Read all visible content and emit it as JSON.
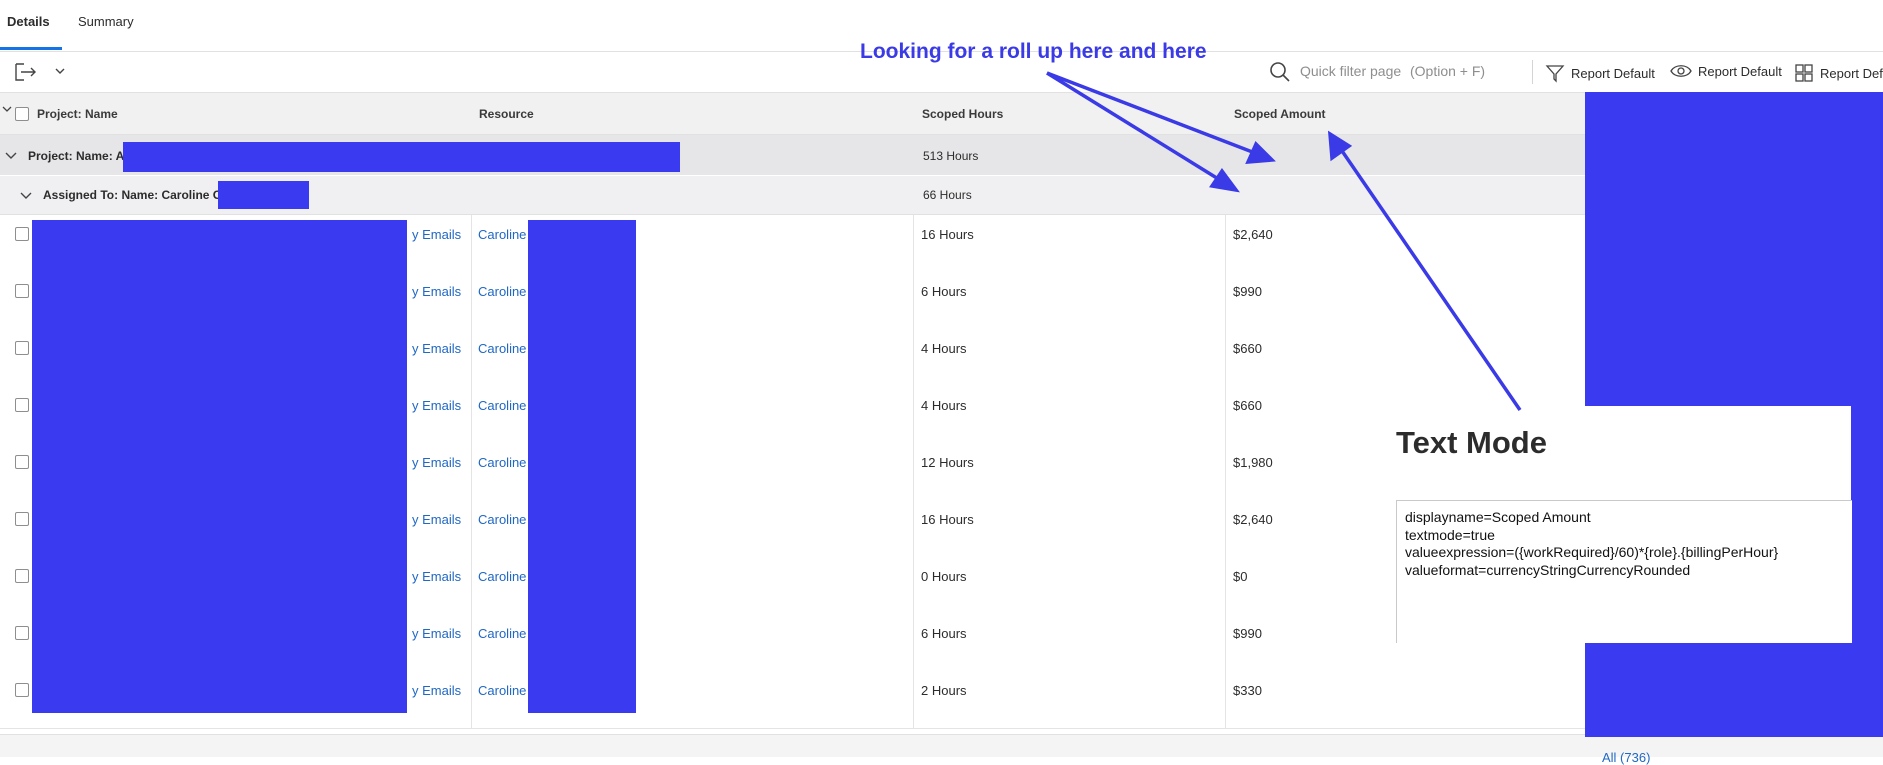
{
  "tabs": [
    {
      "label": "Details",
      "active": true
    },
    {
      "label": "Summary",
      "active": false
    }
  ],
  "toolbar": {
    "filter_placeholder": "Quick filter page",
    "filter_shortcut": "(Option + F)",
    "filter_button": "Report Default",
    "view_button": "Report Default",
    "grouping_button": "Report Defa"
  },
  "table": {
    "headers": [
      "Project: Name",
      "Resource",
      "Scoped Hours",
      "Scoped Amount"
    ],
    "group_project": {
      "label": "Project: Name: A",
      "hours": "513 Hours"
    },
    "group_assigned": {
      "label": "Assigned To: Name: Caroline C",
      "hours": "66 Hours"
    },
    "rows": [
      {
        "task": "y Emails",
        "resource": "Caroline",
        "hours": "16 Hours",
        "amount": "$2,640"
      },
      {
        "task": "y Emails",
        "resource": "Caroline",
        "hours": "6 Hours",
        "amount": "$990"
      },
      {
        "task": "y Emails",
        "resource": "Caroline",
        "hours": "4 Hours",
        "amount": "$660"
      },
      {
        "task": "y Emails",
        "resource": "Caroline",
        "hours": "4 Hours",
        "amount": "$660"
      },
      {
        "task": "y Emails",
        "resource": "Caroline",
        "hours": "12 Hours",
        "amount": "$1,980"
      },
      {
        "task": "y Emails",
        "resource": "Caroline",
        "hours": "16 Hours",
        "amount": "$2,640"
      },
      {
        "task": "y Emails",
        "resource": "Caroline",
        "hours": "0 Hours",
        "amount": "$0"
      },
      {
        "task": "y Emails",
        "resource": "Caroline",
        "hours": "6 Hours",
        "amount": "$990"
      },
      {
        "task": "y Emails",
        "resource": "Caroline",
        "hours": "2 Hours",
        "amount": "$330"
      }
    ]
  },
  "text_mode": {
    "title": "Text Mode",
    "lines": [
      "displayname=Scoped Amount",
      "textmode=true",
      "valueexpression=({workRequired}/60)*{role}.{billingPerHour}",
      "valueformat=currencyStringCurrencyRounded"
    ]
  },
  "annotation": "Looking for a roll up here and here",
  "footer": {
    "link": "All (736)"
  },
  "colors": {
    "redaction": "#3a3af0",
    "annotation": "#3a3ae6",
    "accent": "#1473e6",
    "link": "#2068c4"
  }
}
